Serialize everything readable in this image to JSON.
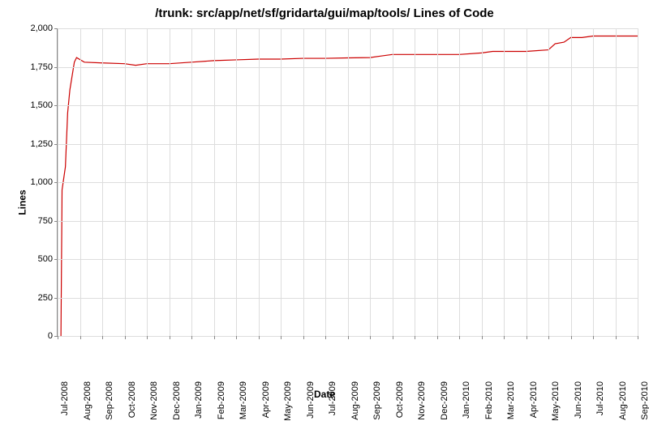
{
  "chart_data": {
    "type": "line",
    "title": "/trunk: src/app/net/sf/gridarta/gui/map/tools/ Lines of Code",
    "xlabel": "Date",
    "ylabel": "Lines",
    "ylim": [
      0,
      2000
    ],
    "yticks": [
      0,
      250,
      500,
      750,
      1000,
      1250,
      1500,
      1750,
      2000
    ],
    "ytick_labels": [
      "0",
      "250",
      "500",
      "750",
      "1,000",
      "1,250",
      "1,500",
      "1,750",
      "2,000"
    ],
    "x_categories": [
      "Jul-2008",
      "Aug-2008",
      "Sep-2008",
      "Oct-2008",
      "Nov-2008",
      "Dec-2008",
      "Jan-2009",
      "Feb-2009",
      "Mar-2009",
      "Apr-2009",
      "May-2009",
      "Jun-2009",
      "Jul-2009",
      "Aug-2009",
      "Sep-2009",
      "Oct-2009",
      "Nov-2009",
      "Dec-2009",
      "Jan-2010",
      "Feb-2010",
      "Mar-2010",
      "Apr-2010",
      "May-2010",
      "Jun-2010",
      "Jul-2010",
      "Aug-2010",
      "Sep-2010"
    ],
    "series": [
      {
        "name": "Lines of Code",
        "color": "#cc0000",
        "points": [
          {
            "x": 0.15,
            "y": 0
          },
          {
            "x": 0.2,
            "y": 950
          },
          {
            "x": 0.3,
            "y": 1050
          },
          {
            "x": 0.35,
            "y": 1100
          },
          {
            "x": 0.45,
            "y": 1450
          },
          {
            "x": 0.55,
            "y": 1600
          },
          {
            "x": 0.75,
            "y": 1780
          },
          {
            "x": 0.85,
            "y": 1810
          },
          {
            "x": 1.2,
            "y": 1780
          },
          {
            "x": 2.0,
            "y": 1775
          },
          {
            "x": 3.0,
            "y": 1770
          },
          {
            "x": 3.5,
            "y": 1760
          },
          {
            "x": 4.0,
            "y": 1770
          },
          {
            "x": 5.0,
            "y": 1770
          },
          {
            "x": 6.0,
            "y": 1780
          },
          {
            "x": 7.0,
            "y": 1790
          },
          {
            "x": 8.0,
            "y": 1795
          },
          {
            "x": 9.0,
            "y": 1800
          },
          {
            "x": 10.0,
            "y": 1800
          },
          {
            "x": 11.0,
            "y": 1805
          },
          {
            "x": 12.0,
            "y": 1805
          },
          {
            "x": 13.0,
            "y": 1808
          },
          {
            "x": 14.0,
            "y": 1810
          },
          {
            "x": 14.5,
            "y": 1820
          },
          {
            "x": 15.0,
            "y": 1830
          },
          {
            "x": 16.0,
            "y": 1830
          },
          {
            "x": 17.0,
            "y": 1830
          },
          {
            "x": 18.0,
            "y": 1830
          },
          {
            "x": 19.0,
            "y": 1840
          },
          {
            "x": 19.5,
            "y": 1850
          },
          {
            "x": 20.0,
            "y": 1850
          },
          {
            "x": 21.0,
            "y": 1850
          },
          {
            "x": 22.0,
            "y": 1860
          },
          {
            "x": 22.3,
            "y": 1900
          },
          {
            "x": 22.7,
            "y": 1910
          },
          {
            "x": 23.0,
            "y": 1940
          },
          {
            "x": 23.5,
            "y": 1940
          },
          {
            "x": 24.0,
            "y": 1950
          },
          {
            "x": 25.0,
            "y": 1950
          },
          {
            "x": 26.0,
            "y": 1950
          }
        ]
      }
    ]
  }
}
